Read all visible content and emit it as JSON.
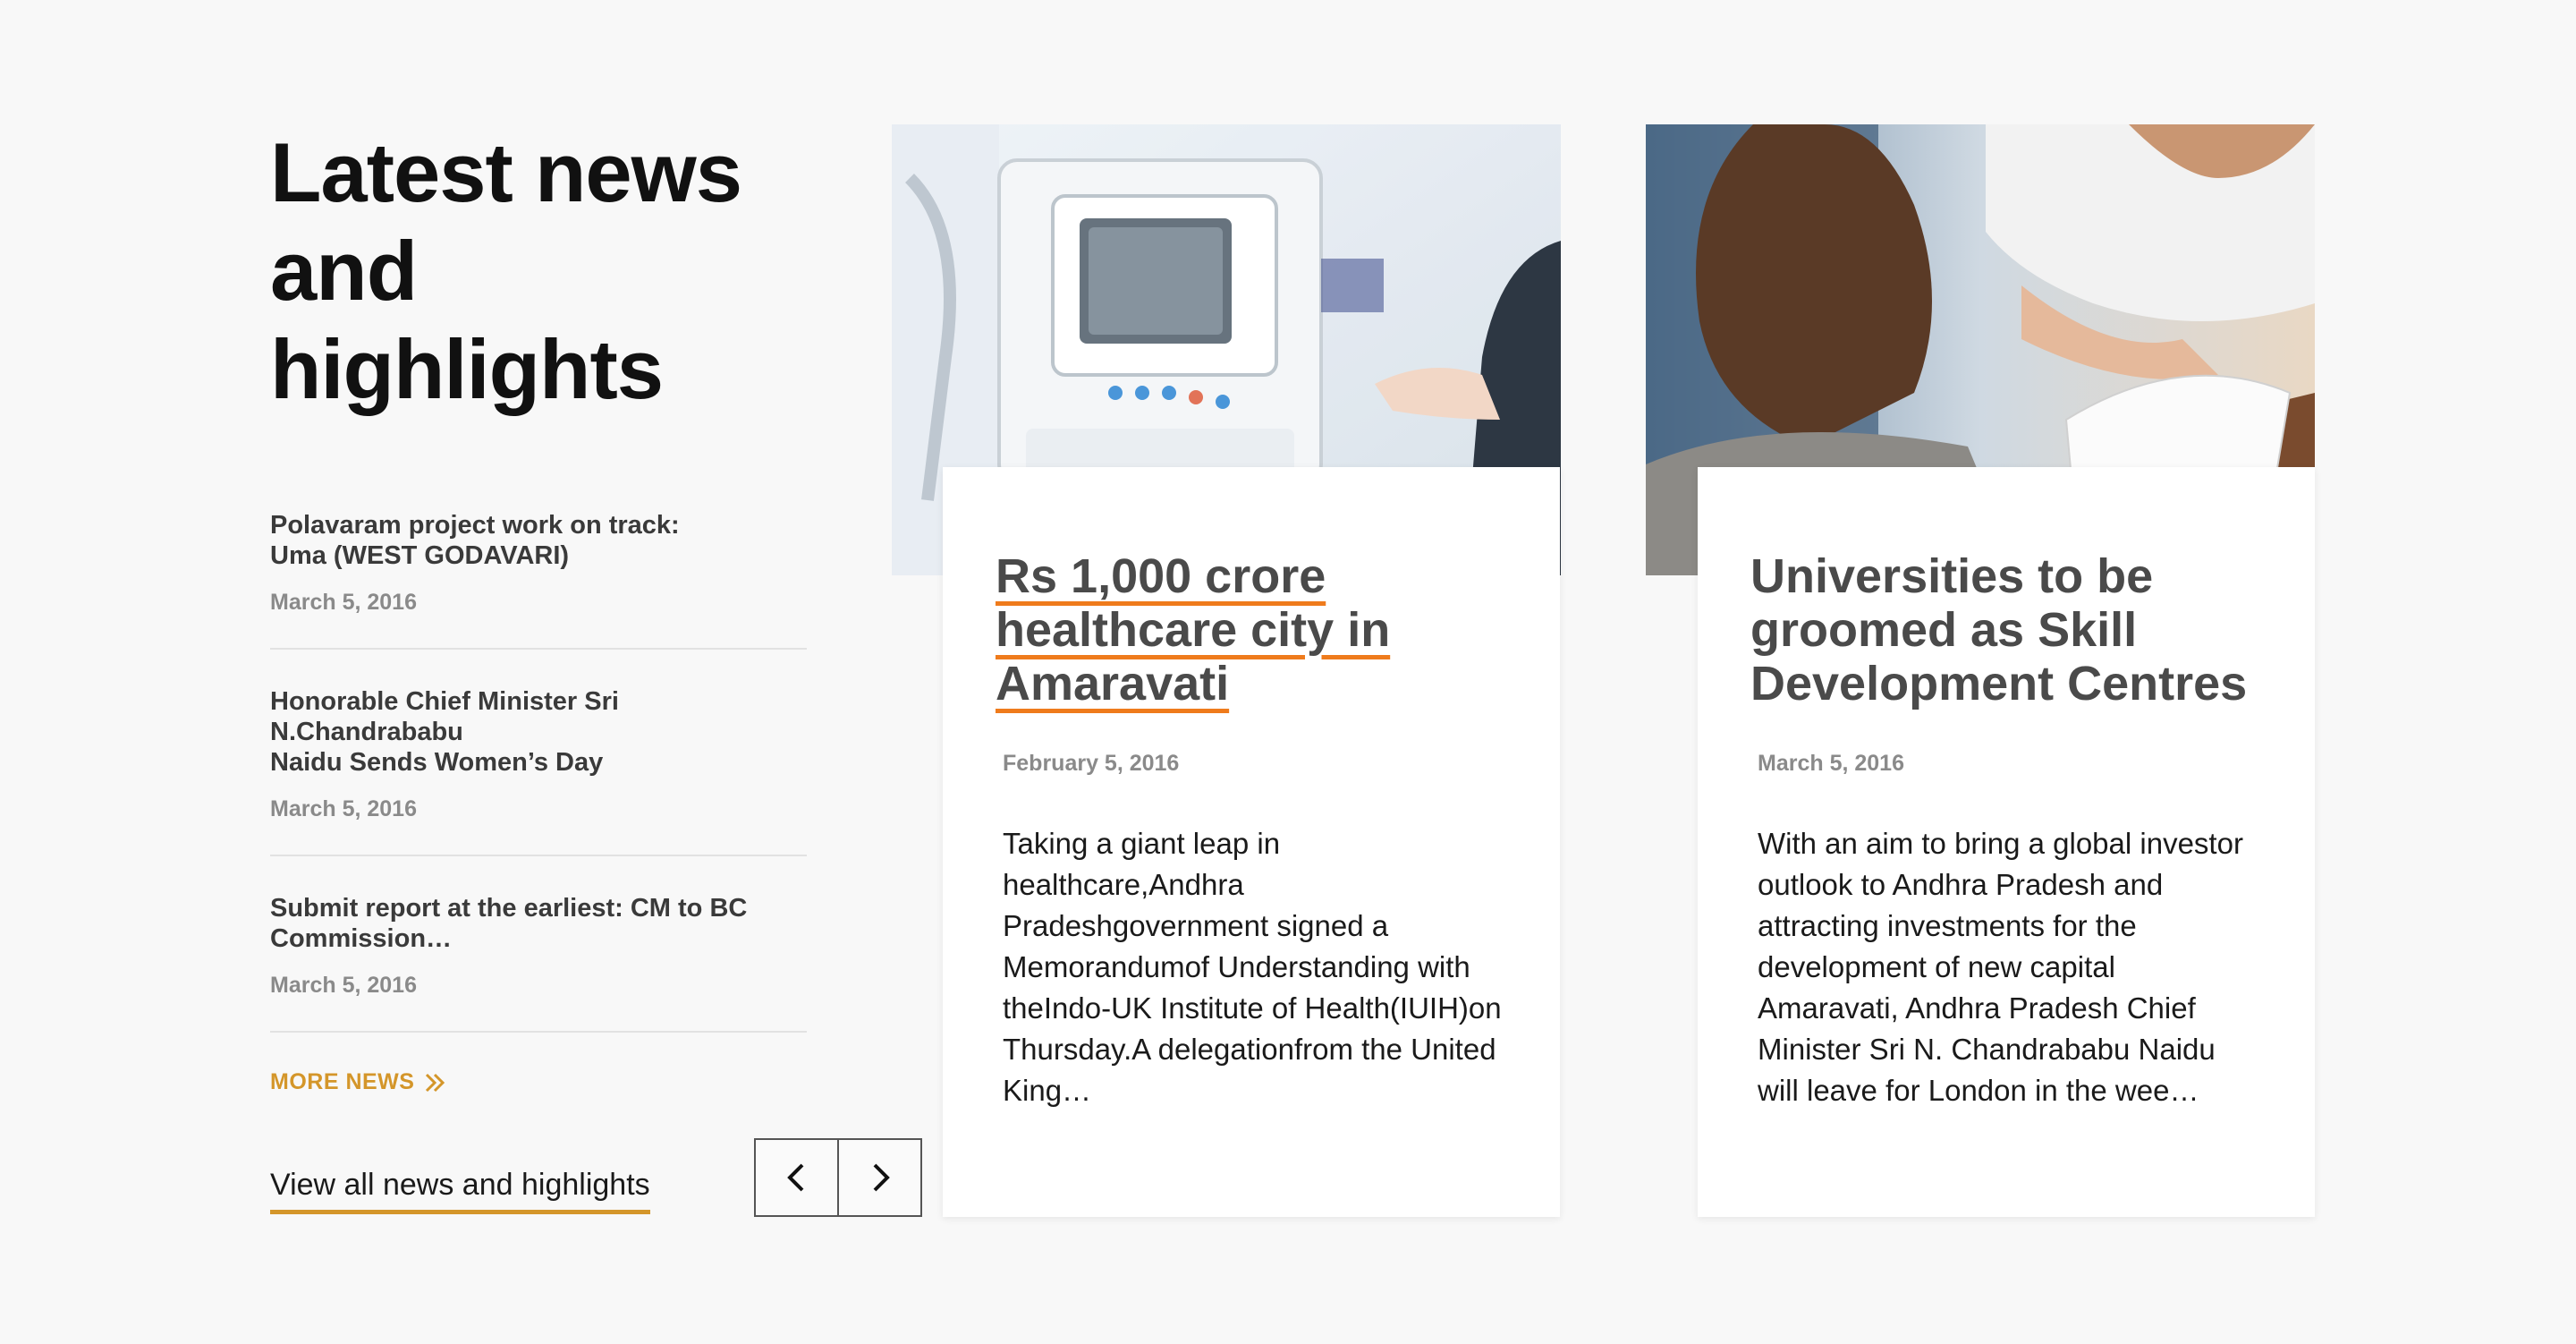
{
  "section": {
    "title_line1": "Latest news",
    "title_line2": "and highlights"
  },
  "news_list": [
    {
      "title": "Polavaram project work on track:\nUma (WEST GODAVARI)",
      "date": "March 5, 2016"
    },
    {
      "title": "Honorable Chief Minister Sri N.Chandrababu\nNaidu Sends Women’s Day",
      "date": "March 5, 2016"
    },
    {
      "title": "Submit report at the earliest: CM to BC\nCommission…",
      "date": "March 5, 2016"
    }
  ],
  "more_news_label": "MORE NEWS",
  "view_all_label": "View all news and highlights",
  "pager": {
    "prev_icon": "chevron-left-icon",
    "next_icon": "chevron-right-icon"
  },
  "cards": [
    {
      "image": "medical-equipment-photo",
      "title": "Rs 1,000 crore healthcare city in Amaravati",
      "title_lines": [
        "Rs 1,000 crore",
        "healthcare city in",
        "Amaravati"
      ],
      "date": "February 5, 2016",
      "body": "Taking  a  giant  leap  in healthcare,Andhra Pradeshgovernment  signed  a Memorandumof Understanding with theIndo-UK Institute of Health(IUIH)on Thursday.A delegationfrom the United King…"
    },
    {
      "image": "students-studying-photo",
      "title": "Universities to be groomed as Skill Development Centres",
      "title_lines": [
        "Universities to be",
        "groomed as Skill",
        "Development Centres"
      ],
      "date": "March 5, 2016",
      "body": "With an aim to bring a global investor outlook to Andhra Pradesh and attracting investments for the development of new capital Amaravati, Andhra Pradesh Chief Minister Sri N. Chandrababu Naidu will leave for London in the wee…"
    }
  ],
  "colors": {
    "accent_gold": "#d4962a",
    "accent_orange": "#ef7b1c",
    "background": "#f8f8f8"
  }
}
